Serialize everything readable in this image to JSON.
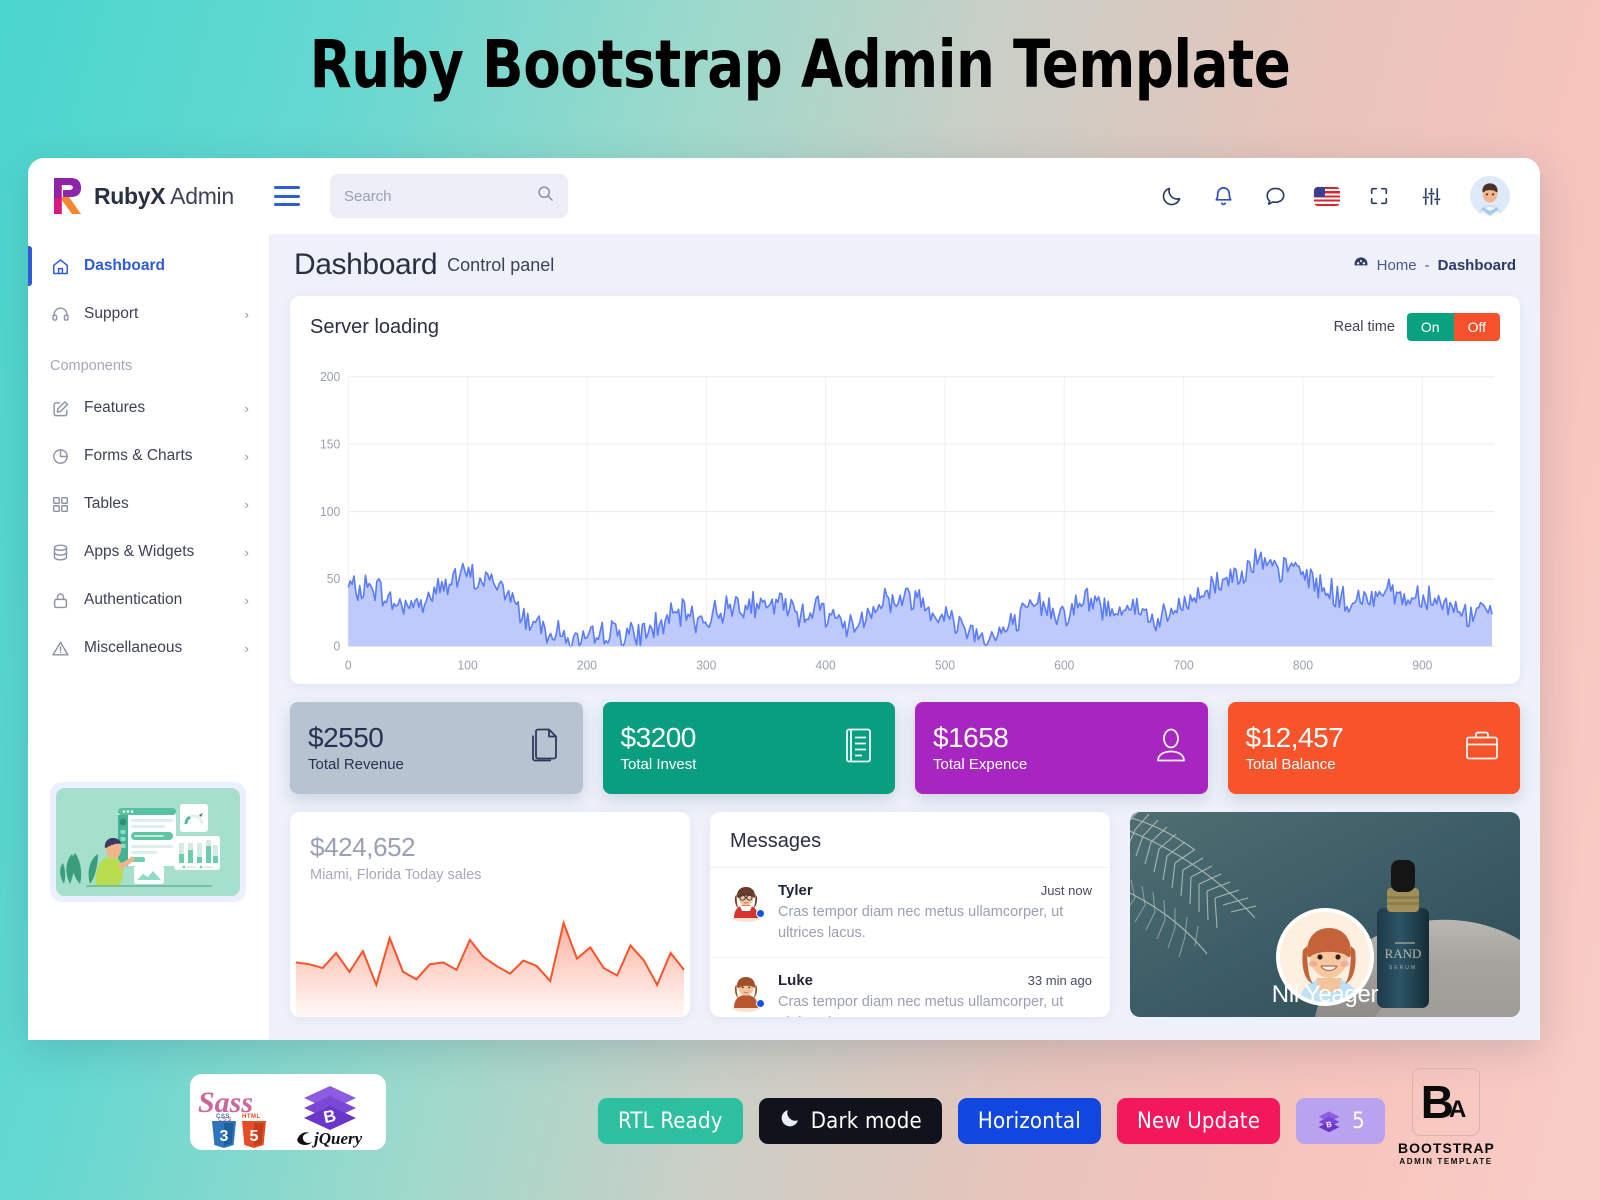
{
  "banner": {
    "title": "Ruby Bootstrap Admin Template"
  },
  "brand": {
    "name_bold": "RubyX",
    "name_rest": " Admin",
    "logo_icon": "rubyx-logo-icon"
  },
  "search": {
    "placeholder": "Search",
    "value": "",
    "icon": "search-icon"
  },
  "topnav": {
    "menu_toggle_icon": "hamburger-icon",
    "icons": [
      {
        "name": "dark-mode-icon",
        "label": "Dark mode"
      },
      {
        "name": "notification-bell-icon",
        "label": "Notifications"
      },
      {
        "name": "chat-bubble-icon",
        "label": "Messages"
      },
      {
        "name": "us-flag-icon",
        "label": "Language"
      },
      {
        "name": "fullscreen-icon",
        "label": "Fullscreen"
      },
      {
        "name": "settings-sliders-icon",
        "label": "Settings"
      },
      {
        "name": "user-avatar-icon",
        "label": "Profile"
      }
    ]
  },
  "sidebar": {
    "items": [
      {
        "label": "Dashboard",
        "icon": "home-icon",
        "active": true,
        "has_children": false
      },
      {
        "label": "Support",
        "icon": "headset-icon",
        "active": false,
        "has_children": true
      }
    ],
    "section_label": "Components",
    "components": [
      {
        "label": "Features",
        "icon": "edit-square-icon",
        "has_children": true
      },
      {
        "label": "Forms & Charts",
        "icon": "pie-chart-icon",
        "has_children": true
      },
      {
        "label": "Tables",
        "icon": "grid-icon",
        "has_children": true
      },
      {
        "label": "Apps & Widgets",
        "icon": "database-icon",
        "has_children": true
      },
      {
        "label": "Authentication",
        "icon": "lock-icon",
        "has_children": true
      },
      {
        "label": "Miscellaneous",
        "icon": "alert-triangle-icon",
        "has_children": true
      }
    ],
    "illustration": "dashboard-illustration"
  },
  "page": {
    "title": "Dashboard",
    "subtitle": "Control panel",
    "breadcrumb": {
      "icon": "speedometer-icon",
      "home": "Home",
      "separator": "-",
      "current": "Dashboard"
    }
  },
  "server_card": {
    "title": "Server loading",
    "realtime_label": "Real time",
    "on_label": "On",
    "off_label": "Off"
  },
  "chart_data": {
    "type": "area",
    "title": "Server loading",
    "xlabel": "",
    "ylabel": "",
    "xlim": [
      0,
      960
    ],
    "ylim": [
      0,
      200
    ],
    "x_ticks": [
      "0",
      "100",
      "200",
      "300",
      "400",
      "500",
      "600",
      "700",
      "800",
      "900"
    ],
    "y_ticks": [
      "0",
      "50",
      "100",
      "150",
      "200"
    ],
    "grid": true,
    "legend": "none",
    "series": [
      {
        "name": "Server load",
        "color": "#5b7cfa",
        "fill": "#b9c7fb",
        "x": [
          0,
          10,
          20,
          30,
          40,
          50,
          60,
          70,
          80,
          90,
          100,
          110,
          120,
          130,
          140,
          150,
          160,
          170,
          180,
          190,
          200,
          210,
          220,
          230,
          240,
          250,
          260,
          270,
          280,
          290,
          300,
          310,
          320,
          330,
          340,
          350,
          360,
          370,
          380,
          390,
          400,
          410,
          420,
          430,
          440,
          450,
          460,
          470,
          480,
          490,
          500,
          510,
          520,
          530,
          540,
          550,
          560,
          570,
          580,
          590,
          600,
          610,
          620,
          630,
          640,
          650,
          660,
          670,
          680,
          690,
          700,
          710,
          720,
          730,
          740,
          750,
          760,
          770,
          780,
          790,
          800,
          810,
          820,
          830,
          840,
          850,
          860,
          870,
          880,
          890,
          900,
          910,
          920,
          930,
          940,
          950,
          960
        ],
        "values": [
          44,
          41,
          46,
          38,
          30,
          33,
          30,
          39,
          46,
          50,
          53,
          48,
          50,
          42,
          31,
          20,
          18,
          12,
          8,
          4,
          2,
          8,
          12,
          10,
          6,
          12,
          16,
          20,
          24,
          22,
          19,
          26,
          30,
          34,
          30,
          27,
          33,
          28,
          24,
          30,
          26,
          20,
          14,
          20,
          30,
          36,
          32,
          38,
          34,
          28,
          22,
          18,
          14,
          9,
          6,
          12,
          18,
          26,
          32,
          28,
          24,
          30,
          34,
          30,
          26,
          32,
          28,
          22,
          18,
          24,
          30,
          36,
          42,
          48,
          52,
          58,
          64,
          58,
          54,
          60,
          55,
          48,
          42,
          36,
          30,
          34,
          40,
          44,
          38,
          34,
          40,
          36,
          30,
          26,
          22,
          28,
          24
        ]
      }
    ]
  },
  "stats": [
    {
      "value": "$2550",
      "label": "Total Revenue",
      "icon": "copy-files-icon",
      "theme": "gray",
      "color": "#b8c3d2"
    },
    {
      "value": "$3200",
      "label": "Total Invest",
      "icon": "document-list-icon",
      "theme": "teal",
      "color": "#0a9e81"
    },
    {
      "value": "$1658",
      "label": "Total Expence",
      "icon": "person-icon",
      "theme": "purple",
      "color": "#a726c1"
    },
    {
      "value": "$12,457",
      "label": "Total Balance",
      "icon": "briefcase-icon",
      "theme": "orange",
      "color": "#f7542b"
    }
  ],
  "sales_card": {
    "value": "$424,652",
    "subtitle": "Miami, Florida Today sales",
    "spark_color": "#f7542b",
    "chart_data": {
      "type": "area",
      "title": "Miami, Florida Today sales",
      "values": [
        54,
        52,
        48,
        64,
        44,
        66,
        30,
        80,
        44,
        36,
        52,
        54,
        46,
        78,
        60,
        50,
        42,
        56,
        50,
        34,
        96,
        58,
        70,
        48,
        40,
        72,
        56,
        30,
        64,
        46
      ]
    }
  },
  "messages": {
    "title": "Messages",
    "items": [
      {
        "name": "Tyler",
        "time": "Just now",
        "text": "Cras tempor diam nec metus ullamcorper, ut ultrices lacus.",
        "avatar": "avatar-tyler",
        "unread": true
      },
      {
        "name": "Luke",
        "time": "33 min ago",
        "text": "Cras tempor diam nec metus ullamcorper, ut ultrices lacus.",
        "avatar": "avatar-luke",
        "unread": true
      }
    ]
  },
  "photo_card": {
    "name": "Nil Yeager",
    "image": "serum-product-photo",
    "avatar": "avatar-nil-yeager"
  },
  "footer": {
    "tech_logos": [
      "sass-logo",
      "css3-logo",
      "html5-logo",
      "bootstrap-logo",
      "jquery-logo"
    ],
    "badges": [
      {
        "label": "RTL Ready",
        "theme": "b-rtl",
        "icon": "",
        "color": "#2cbfa0"
      },
      {
        "label": "Dark mode",
        "theme": "b-dark",
        "icon": "moon-icon",
        "color": "#10131c"
      },
      {
        "label": "Horizontal",
        "theme": "b-horiz",
        "icon": "",
        "color": "#1246e0"
      },
      {
        "label": "New Update",
        "theme": "b-new",
        "icon": "",
        "color": "#f3175c"
      },
      {
        "label": "5",
        "theme": "b-bs",
        "icon": "bootstrap-icon",
        "color": "#b9a3ef"
      }
    ],
    "brand": {
      "mark_b": "B",
      "mark_a": "A",
      "caption1": "BOOTSTRAP",
      "caption2": "ADMIN TEMPLATE"
    }
  }
}
